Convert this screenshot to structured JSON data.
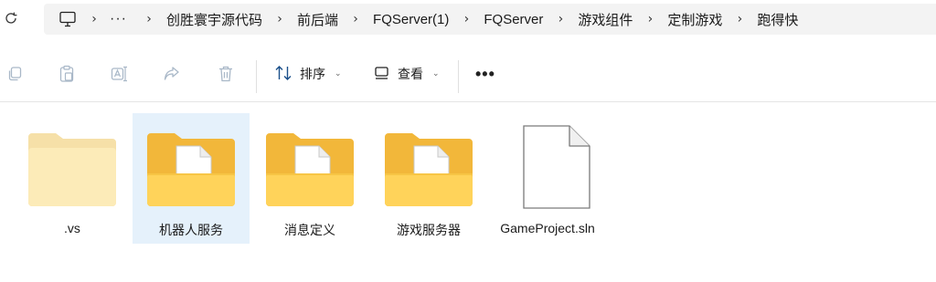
{
  "breadcrumb": {
    "overflow": "···",
    "items": [
      "创胜寰宇源代码",
      "前后端",
      "FQServer(1)",
      "FQServer",
      "游戏组件",
      "定制游戏",
      "跑得快"
    ]
  },
  "toolbar": {
    "sort_label": "排序",
    "view_label": "查看"
  },
  "files": [
    {
      "name": ".vs",
      "type": "folder-empty",
      "selected": false
    },
    {
      "name": "机器人服务",
      "type": "folder",
      "selected": true
    },
    {
      "name": "消息定义",
      "type": "folder",
      "selected": false
    },
    {
      "name": "游戏服务器",
      "type": "folder",
      "selected": false
    },
    {
      "name": "GameProject.sln",
      "type": "file",
      "selected": false
    }
  ],
  "colors": {
    "folder_back": "#F2B73A",
    "folder_front": "#FFD35A",
    "folder_faded_back": "#F6E0A8",
    "folder_faded_front": "#FCEBB8",
    "selection": "#E5F1FB"
  }
}
